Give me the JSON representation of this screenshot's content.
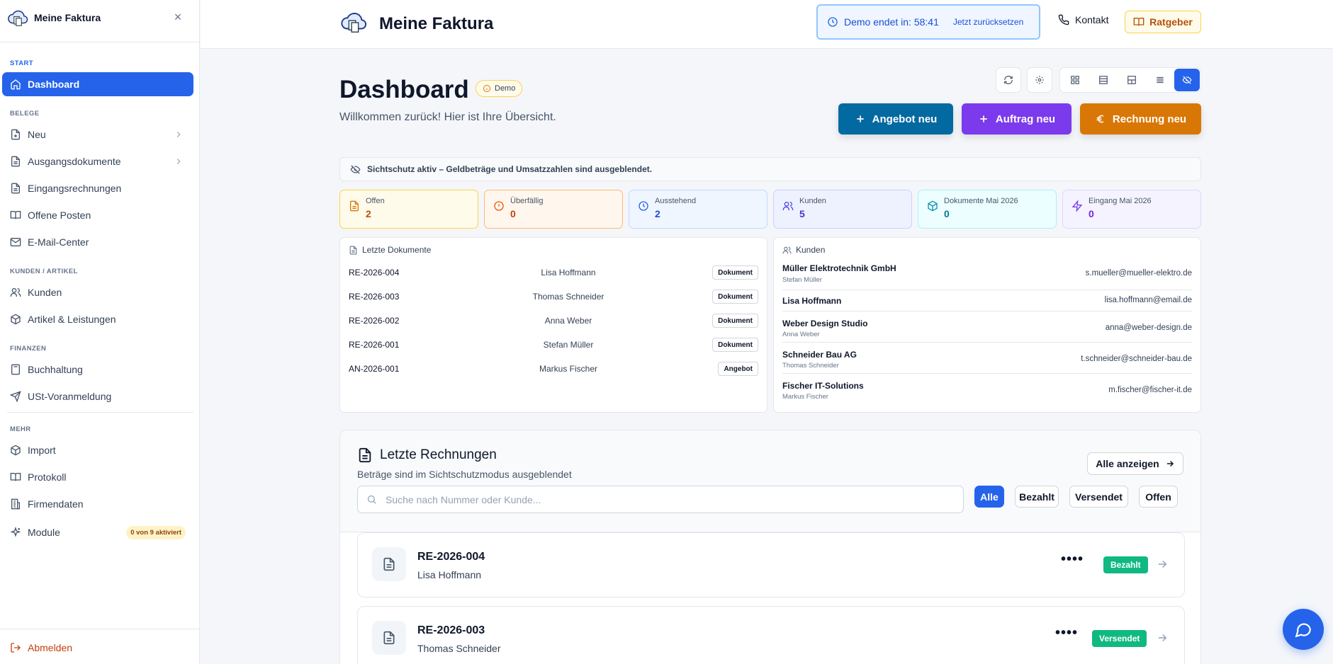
{
  "app": {
    "title": "Meine Faktura"
  },
  "sidebar": {
    "sections": {
      "start": "START",
      "belege": "BELEGE",
      "kunden": "KUNDEN / ARTIKEL",
      "finanzen": "FINANZEN",
      "mehr": "MEHR"
    },
    "items": [
      {
        "label": "Dashboard",
        "icon": "home-icon"
      },
      {
        "label": "Neu",
        "icon": "file-plus-icon"
      },
      {
        "label": "Ausgangsdokumente",
        "icon": "file-text-icon"
      },
      {
        "label": "Eingangsrechnungen",
        "icon": "file-text-icon"
      },
      {
        "label": "Offene Posten",
        "icon": "book-open-icon"
      },
      {
        "label": "E-Mail-Center",
        "icon": "mail-icon"
      },
      {
        "label": "Kunden",
        "icon": "users-icon"
      },
      {
        "label": "Artikel & Leistungen",
        "icon": "package-icon"
      },
      {
        "label": "Buchhaltung",
        "icon": "calculator-icon"
      },
      {
        "label": "USt-Voranmeldung",
        "icon": "send-icon"
      },
      {
        "label": "Import",
        "icon": "package-icon"
      },
      {
        "label": "Protokoll",
        "icon": "book-icon"
      },
      {
        "label": "Firmendaten",
        "icon": "building-icon"
      },
      {
        "label": "Module",
        "icon": "sparkles-icon"
      }
    ],
    "module_badge": "0 von 9 aktiviert",
    "logout": "Abmelden"
  },
  "header": {
    "title": "Meine Faktura",
    "demo_timer": "Demo endet in: 58:41",
    "demo_reset": "Jetzt zurücksetzen",
    "contact": "Kontakt",
    "guide": "Ratgeber"
  },
  "page": {
    "title": "Dashboard",
    "badge": "Demo",
    "subtitle": "Willkommen zurück! Hier ist Ihre Übersicht."
  },
  "actions": {
    "offer": "Angebot neu",
    "order": "Auftrag neu",
    "invoice": "Rechnung neu"
  },
  "privacy_notice": "Sichtschutz aktiv – Geldbeträge und Umsatzzahlen sind ausgeblendet.",
  "stats": [
    {
      "label": "Offen",
      "value": "2"
    },
    {
      "label": "Überfällig",
      "value": "0"
    },
    {
      "label": "Ausstehend",
      "value": "2"
    },
    {
      "label": "Kunden",
      "value": "5"
    },
    {
      "label": "Dokumente Mai 2026",
      "value": "0"
    },
    {
      "label": "Eingang Mai 2026",
      "value": "0"
    }
  ],
  "recent_docs": {
    "title": "Letzte Dokumente",
    "rows": [
      {
        "number": "RE-2026-004",
        "customer": "Lisa Hoffmann",
        "type": "Dokument"
      },
      {
        "number": "RE-2026-003",
        "customer": "Thomas Schneider",
        "type": "Dokument"
      },
      {
        "number": "RE-2026-002",
        "customer": "Anna Weber",
        "type": "Dokument"
      },
      {
        "number": "RE-2026-001",
        "customer": "Stefan Müller",
        "type": "Dokument"
      },
      {
        "number": "AN-2026-001",
        "customer": "Markus Fischer",
        "type": "Angebot"
      }
    ]
  },
  "customers": {
    "title": "Kunden",
    "rows": [
      {
        "name": "Müller Elektrotechnik GmbH",
        "contact": "Stefan Müller",
        "email": "s.mueller@mueller-elektro.de"
      },
      {
        "name": "Lisa Hoffmann",
        "contact": "",
        "email": "lisa.hoffmann@email.de"
      },
      {
        "name": "Weber Design Studio",
        "contact": "Anna Weber",
        "email": "anna@weber-design.de"
      },
      {
        "name": "Schneider Bau AG",
        "contact": "Thomas Schneider",
        "email": "t.schneider@schneider-bau.de"
      },
      {
        "name": "Fischer IT-Solutions",
        "contact": "Markus Fischer",
        "email": "m.fischer@fischer-it.de"
      }
    ]
  },
  "invoices": {
    "title": "Letzte Rechnungen",
    "subtitle": "Beträge sind im Sichtschutzmodus ausgeblendet",
    "show_all": "Alle anzeigen",
    "search_placeholder": "Suche nach Nummer oder Kunde...",
    "filters": [
      "Alle",
      "Bezahlt",
      "Versendet",
      "Offen"
    ],
    "rows": [
      {
        "number": "RE-2026-004",
        "customer": "Lisa Hoffmann",
        "amount": "••••",
        "status": "Bezahlt"
      },
      {
        "number": "RE-2026-003",
        "customer": "Thomas Schneider",
        "amount": "••••",
        "status": "Versendet"
      }
    ]
  },
  "colors": {
    "accent": "#2563eb",
    "offer": "#0369a1",
    "order": "#7c3aed",
    "invoice": "#d97706",
    "status_green": "#10b981"
  }
}
